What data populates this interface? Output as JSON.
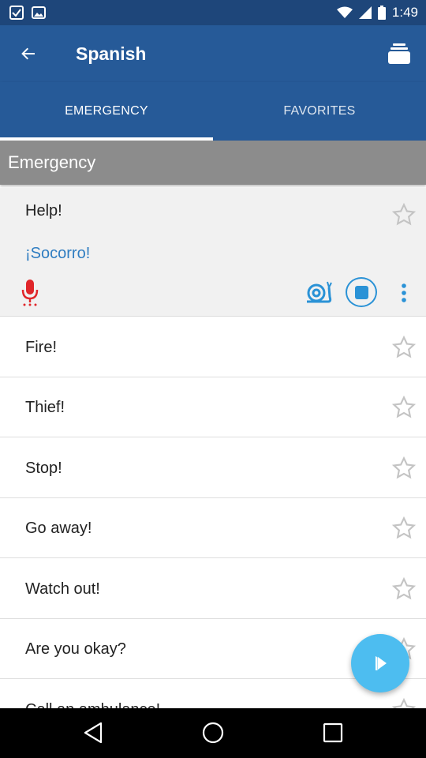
{
  "status_bar": {
    "time": "1:49"
  },
  "app_bar": {
    "title": "Spanish"
  },
  "tabs": [
    {
      "label": "EMERGENCY",
      "selected": true
    },
    {
      "label": "FAVORITES",
      "selected": false
    }
  ],
  "section": {
    "title": "Emergency"
  },
  "expanded_item": {
    "phrase": "Help!",
    "translation": "¡Socorro!"
  },
  "items": [
    {
      "phrase": "Fire!"
    },
    {
      "phrase": "Thief!"
    },
    {
      "phrase": "Stop!"
    },
    {
      "phrase": "Go away!"
    },
    {
      "phrase": "Watch out!"
    },
    {
      "phrase": "Are you okay?"
    },
    {
      "phrase": "Call an ambulance!"
    }
  ],
  "colors": {
    "app_bar": "#265a98",
    "status_bar": "#1e467a",
    "section_header": "#8c8c8c",
    "translation_text": "#2f7dc1",
    "mic_red": "#e0262a",
    "fab_blue": "#4dbdf0"
  },
  "icons": [
    "back-arrow-icon",
    "flashcards-icon",
    "star-icon",
    "microphone-icon",
    "snail-slow-icon",
    "stop-icon",
    "more-vert-icon",
    "play-icon",
    "nav-back-icon",
    "nav-home-icon",
    "nav-recents-icon"
  ]
}
